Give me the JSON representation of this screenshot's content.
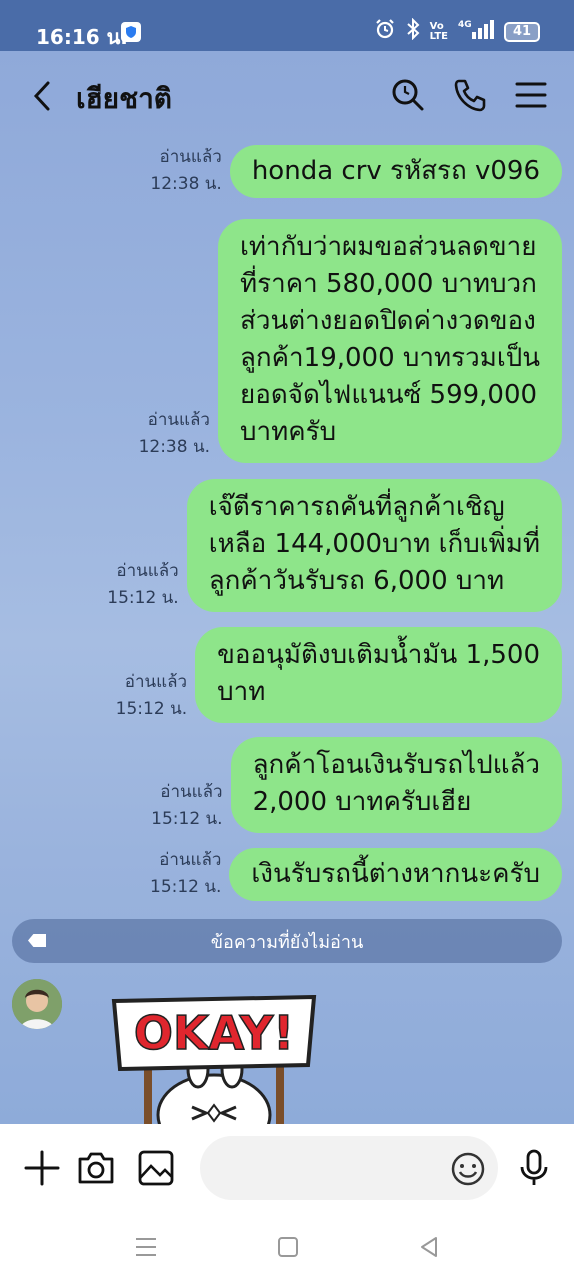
{
  "status_bar": {
    "time": "16:16 น.",
    "battery": "41",
    "volte": "Vo\nLTE",
    "network": "4G"
  },
  "header": {
    "title": "เฮียชาติ"
  },
  "messages": [
    {
      "status": "อ่านแล้ว",
      "time": "12:38 น.",
      "text": "honda crv รหัสรถ v096"
    },
    {
      "status": "อ่านแล้ว",
      "time": "12:38 น.",
      "text": "เท่ากับว่าผมขอส่วนลดขาย\nที่ราคา 580,000 บาทบวก\nส่วนต่างยอดปิดค่างวดของ\nลูกค้า19,000 บาทรวมเป็น\nยอดจัดไฟแนนซ์ 599,000\nบาทครับ"
    },
    {
      "status": "อ่านแล้ว",
      "time": "15:12 น.",
      "text": "เจ๊ตีราคารถคันที่ลูกค้าเชิญ\nเหลือ 144,000บาท เก็บเพิ่มที่\nลูกค้าวันรับรถ 6,000 บาท"
    },
    {
      "status": "อ่านแล้ว",
      "time": "15:12 น.",
      "text": "ขออนุมัติงบเติมน้ำมัน 1,500\nบาท"
    },
    {
      "status": "อ่านแล้ว",
      "time": "15:12 น.",
      "text": "ลูกค้าโอนเงินรับรถไปแล้ว\n2,000 บาทครับเฮีย"
    },
    {
      "status": "อ่านแล้ว",
      "time": "15:12 น.",
      "text": "เงินรับรถนี้ต่างหากนะครับ"
    }
  ],
  "unread_label": "ข้อความที่ยังไม่อ่าน",
  "sticker": {
    "text": "OKAY!"
  },
  "input": {
    "placeholder": ""
  },
  "colors": {
    "bubble": "#8ee58a",
    "status_bar": "#4a6ca8",
    "chat_bg": "#9bb4df"
  }
}
